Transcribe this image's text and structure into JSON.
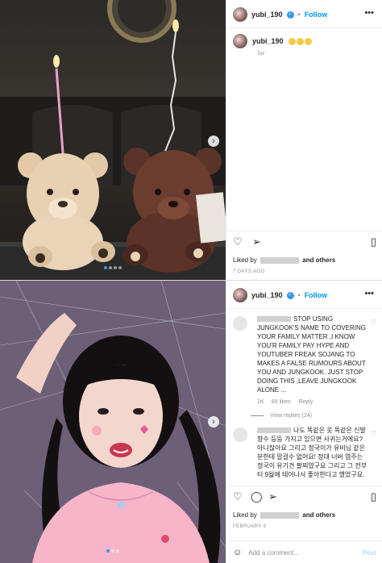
{
  "post1": {
    "username": "yubi_190",
    "separator": "•",
    "follow_label": "Follow",
    "caption_username": "yubi_190",
    "caption_text": "😊😊😊",
    "caption_time": "1w",
    "liked_prefix": "Liked by",
    "liked_suffix": "and others",
    "date": "7 DAYS AGO",
    "icons": {
      "like": "heart-icon",
      "share": "send-icon",
      "save": "bookmark-icon",
      "next": "chevron-right-icon",
      "more": "more-icon"
    }
  },
  "post2": {
    "username": "yubi_190",
    "separator": "•",
    "follow_label": "Follow",
    "comment1": {
      "text": "STOP USING JUNGKOOK'S NAME TO COVERING YOUR FAMILY MATTER ,I KNOW YOU'R FAMILY PAY HYPE AND YOUTUBER FREAK SOJANG TO MAKES A FALSE RUMOURS ABOUT YOU AND JUNGKOOK. JUST STOP DOING THIS ,LEAVE JUNGKOOK ALONE ...",
      "time": "2d",
      "likes": "89 likes",
      "reply": "Reply"
    },
    "view_replies": "View replies (24)",
    "comment2": {
      "text": "나도 똑같은 옷 똑같은 신발 향수 등등 가지고 있으면 사귀는거에요?아니잖아요 그리고 정국이가 유비님 같은 분한테 말걸수 없어요! 정대 너버 염주는 정국이 유기견 팔찌였구요 그리고 그 전부터 9월에 테어나서 좋아한다고 했었구요."
    },
    "liked_prefix": "Liked by",
    "liked_suffix": "and others",
    "date": "FEBRUARY 6",
    "add_comment_placeholder": "Add a comment...",
    "post_label": "Post"
  }
}
